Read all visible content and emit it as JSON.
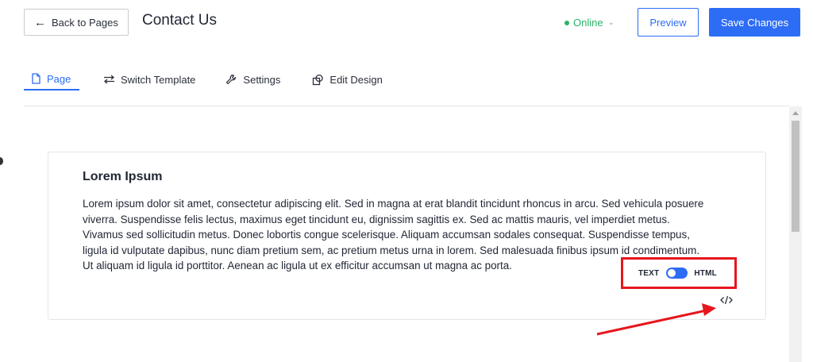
{
  "header": {
    "back_label": "Back to Pages",
    "title": "Contact Us",
    "status": "Online",
    "preview_label": "Preview",
    "save_label": "Save Changes"
  },
  "tabs": [
    {
      "label": "Page",
      "icon": "page-icon",
      "active": true
    },
    {
      "label": "Switch Template",
      "icon": "swap-arrows-icon",
      "active": false
    },
    {
      "label": "Settings",
      "icon": "wrench-icon",
      "active": false
    },
    {
      "label": "Edit Design",
      "icon": "design-icon",
      "active": false
    }
  ],
  "card": {
    "heading": "Lorem Ipsum",
    "body": "Lorem ipsum dolor sit amet, consectetur adipiscing elit. Sed in magna at erat blandit tincidunt rhoncus in arcu. Sed vehicula posuere viverra. Suspendisse felis lectus, maximus eget tincidunt eu, dignissim sagittis ex. Sed ac mattis mauris, vel imperdiet metus. Vivamus sed sollicitudin metus. Donec lobortis congue scelerisque. Aliquam accumsan sodales consequat. Suspendisse tempus, ligula id vulputate dapibus, nunc diam pretium sem, ac pretium metus urna in lorem. Sed malesuada finibus ipsum id condimentum. Ut aliquam id ligula id porttitor. Aenean ac ligula ut ex efficitur accumsan ut magna ac porta."
  },
  "editor_toggle": {
    "left_label": "TEXT",
    "right_label": "HTML",
    "state": "on"
  },
  "colors": {
    "accent": "#2d6df6",
    "online": "#2bb36a",
    "annotation": "#e6161d"
  }
}
